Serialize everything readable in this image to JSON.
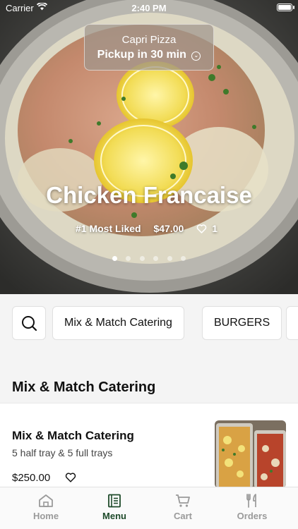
{
  "status_bar": {
    "carrier": "Carrier",
    "time": "2:40 PM"
  },
  "pickup": {
    "store": "Capri Pizza",
    "line": "Pickup in 30 min"
  },
  "hero": {
    "title": "Chicken Francaise",
    "rank": "#1 Most Liked",
    "price": "$47.00",
    "likes": "1",
    "slides": 6,
    "active_slide": 1
  },
  "categories": [
    {
      "label": "Mix & Match Catering"
    },
    {
      "label": "BURGERS"
    }
  ],
  "section": {
    "title": "Mix & Match Catering"
  },
  "item": {
    "name": "Mix & Match Catering",
    "description": "5 half tray & 5 full trays",
    "price": "$250.00"
  },
  "tabs": [
    {
      "label": "Home",
      "icon": "home-icon",
      "active": false
    },
    {
      "label": "Menu",
      "icon": "menu-icon",
      "active": true
    },
    {
      "label": "Cart",
      "icon": "cart-icon",
      "active": false
    },
    {
      "label": "Orders",
      "icon": "orders-icon",
      "active": false
    }
  ],
  "colors": {
    "accent": "#1e4a2a",
    "inactive": "#9a9a9a"
  }
}
